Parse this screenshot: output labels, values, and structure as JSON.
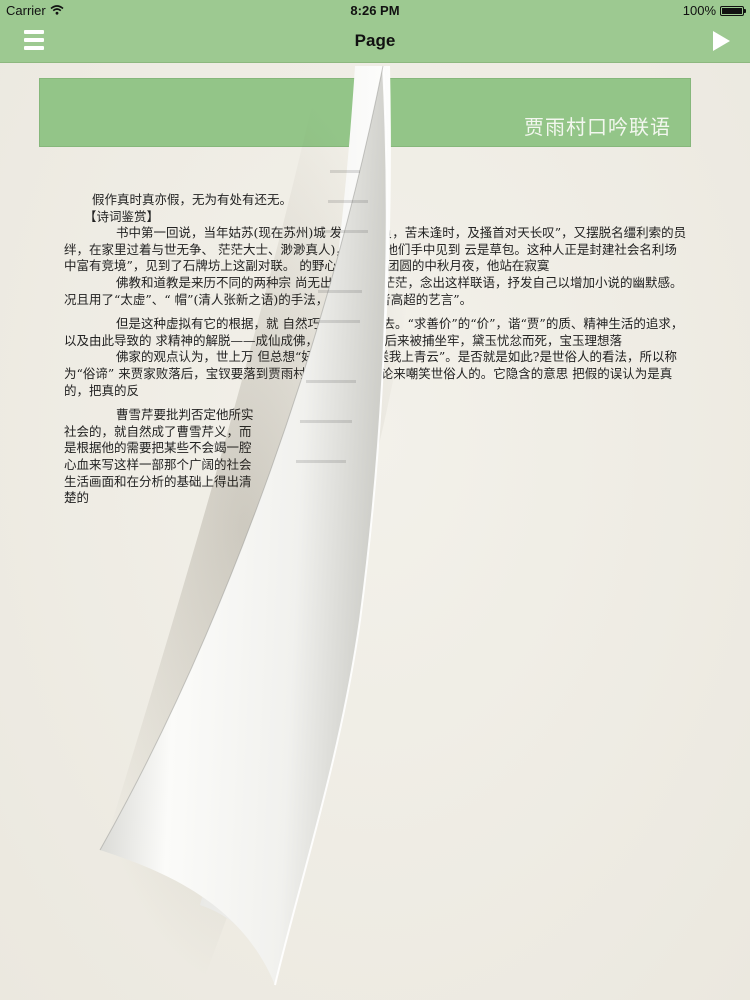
{
  "status_bar": {
    "carrier": "Carrier",
    "time": "8:26 PM",
    "battery": "100%"
  },
  "nav": {
    "title": "Page",
    "left_icon": "menu-icon",
    "right_icon": "play-icon"
  },
  "chapter": {
    "title": "贾雨村口吟联语"
  },
  "body": {
    "paragraphs": [
      "假作真时真亦假，无为有处有还无。",
      "【诗词鉴赏】",
      "书中第一回说，当年姑苏(现在苏州)城                  发平生抱负，苦未逢时，及搔首对天长叹”，又摆脱名缰利索的员绊，在家里过着与世无争、           茫茫大士、渺渺真人)，有幸在他们手中见到              云是草包。这种人正是封建社会名利场中富有竞境”，见到了石牌坊上这副对联。                      的野心。在万家团圆的中秋月夜，他站在寂寞",
      "佛教和道教是来历不同的两种宗               尚无出路，前程茫茫，念出这样联语，抒发自己以增加小说的幽默感。况且用了“太虚”、“           帽”(清人张新之语)的手法，表现了作者高超的艺言”。",
      "但是这种虚拟有它的根据，就           自然巧妙地嵌了进去。“求善价”的“价”，谐“贾”的质、精神生活的追求，以及由此导致的           求精神的解脱——成仙成佛，才是有              宝玉后来被捕坐牢，黛玉忧忿而死，宝玉理想落",
      "佛家的观点认为，世上万           但总想“好风凭借力，送我上青云”。是否就是如此?是世俗人的看法，所以称为“俗谛”            来贾家败落后，宝钗要落到贾雨村手里，给他做论来嘲笑世俗人的。它隐含的意思             把假的误认为是真的，把真的反",
      "曹雪芹要批判否定他所实社会的，就自然成了曹雪芹义，而是根据他的需要把某些不会竭一腔心血来写这样一部那个广阔的社会生活画面和在分析的基础上得出清楚的"
    ]
  }
}
